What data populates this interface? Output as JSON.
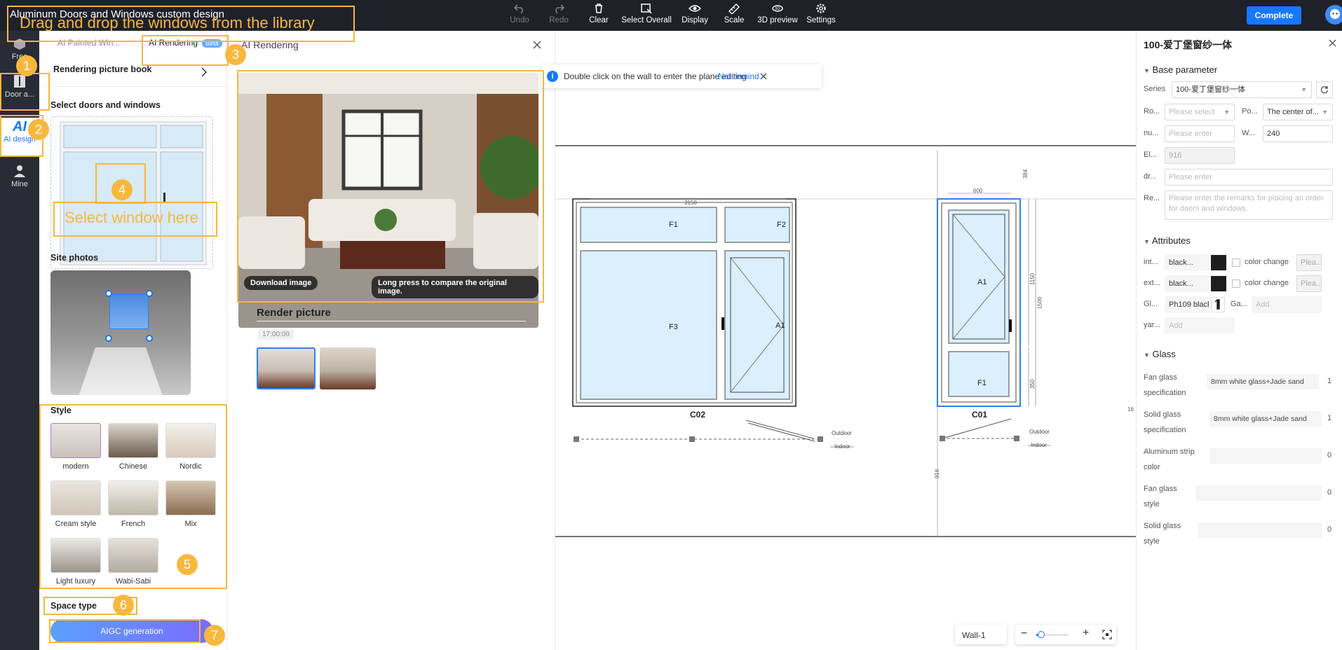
{
  "app": {
    "title": "Aluminum Doors and Windows custom design"
  },
  "toolbar": {
    "undo": "Undo",
    "redo": "Redo",
    "clear": "Clear",
    "select_overall": "Select Overall",
    "display": "Display",
    "scale": "Scale",
    "preview_3d": "3D preview",
    "settings": "Settings",
    "complete": "Complete"
  },
  "rail": {
    "free": "Free",
    "doors": "Door a...",
    "ai_design": "AI design",
    "mine": "Mine"
  },
  "panel": {
    "tab_painted": "AI Painted Win...",
    "tab_rendering": "AI Rendering",
    "beta": "Beta",
    "picture_book": "Rendering picture book",
    "select_title": "Select doors and windows",
    "site_photos": "Site photos",
    "style_title": "Style",
    "styles": [
      "modern",
      "Chinese",
      "Nordic",
      "Cream style",
      "French",
      "Mix",
      "Light luxury",
      "Wabi-Sabi"
    ],
    "space_type": "Space type",
    "aigc": "AIGC generation"
  },
  "render": {
    "title": "AI Rendering",
    "download": "Download image",
    "compare": "Long press to compare the original image.",
    "render_picture": "Render picture",
    "time": "17:00:00"
  },
  "canvas": {
    "tip": "Double click on the wall to enter the plane editing",
    "not_remind": "Not remind",
    "c02_label": "C02",
    "c01_label": "C01",
    "panes": {
      "f1": "F1",
      "f2": "F2",
      "f3": "F3",
      "a1": "A1",
      "c01_a1": "A1",
      "c01_f1": "F1"
    },
    "dims": {
      "top": "3150",
      "c01_width": "600",
      "d384": "384",
      "d1150": "1150",
      "d1500": "1500",
      "d350": "350",
      "d916": "916",
      "edge": "16"
    },
    "outdoor": "Outdoor",
    "indoor": "Indoor",
    "wall": "Wall-1"
  },
  "props": {
    "title": "100-爱丁堡窗纱一体",
    "base_param": "Base parameter",
    "series_label": "Series",
    "series_value": "100-爱丁堡窗纱一体",
    "ro_label": "Ro...",
    "ro_placeholder": "Please select",
    "po_label": "Po...",
    "po_value": "The center of...",
    "nu_label": "nu...",
    "nu_placeholder": "Please enter",
    "w_label": "W...",
    "w_value": "240",
    "el_label": "El...",
    "el_value": "916",
    "dr_label": "dr...",
    "dr_placeholder": "Please enter",
    "re_label": "Re...",
    "re_placeholder": "Please enter the remarks for placing an order for doors and windows.",
    "attributes": "Attributes",
    "int_label": "int...",
    "int_value": "black...",
    "color_change": "color change",
    "plea": "Plea...",
    "ext_label": "ext...",
    "ext_value": "black...",
    "gl_label": "Gl...",
    "gl_value": "Ph109 black",
    "ga_label": "Ga...",
    "add": "Add",
    "yar_label": "yar...",
    "glass": "Glass",
    "fan_spec_label": "Fan glass specification",
    "fan_spec_value": "8mm white glass+Jade sand",
    "fan_spec_qty": "1",
    "solid_spec_label": "Solid glass specification",
    "solid_spec_value": "8mm white glass+Jade sand",
    "solid_spec_qty": "1",
    "strip_label": "Aluminum strip color",
    "strip_qty": "0",
    "fan_style_label": "Fan glass style",
    "fan_style_qty": "0",
    "solid_style_label": "Solid glass style",
    "solid_style_qty": "0"
  },
  "annotations": {
    "banner": "Drag and drop the windows from the library",
    "select_hint": "Select window here",
    "n1": "1",
    "n2": "2",
    "n3": "3",
    "n4": "4",
    "n5": "5",
    "n6": "6",
    "n7": "7"
  }
}
